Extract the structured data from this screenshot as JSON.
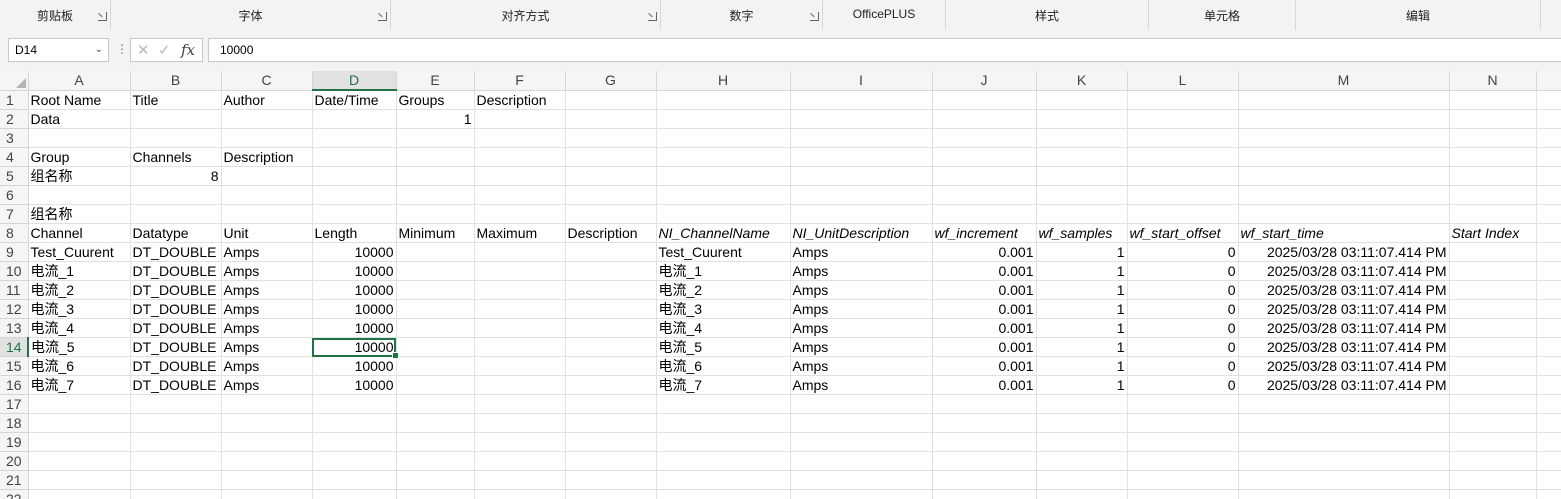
{
  "ribbon": {
    "groups": [
      {
        "label": "剪贴板",
        "launcher": true
      },
      {
        "label": "字体",
        "launcher": true
      },
      {
        "label": "对齐方式",
        "launcher": true
      },
      {
        "label": "数字",
        "launcher": true
      },
      {
        "label": "OfficePLUS",
        "launcher": false
      },
      {
        "label": "样式",
        "launcher": false
      },
      {
        "label": "单元格",
        "launcher": false
      },
      {
        "label": "编辑",
        "launcher": false
      }
    ]
  },
  "formula_bar": {
    "name_box": "D14",
    "formula": "10000",
    "cancel_icon": "✕",
    "enter_icon": "✓",
    "fx_icon": "fx"
  },
  "sheet": {
    "columns": [
      "A",
      "B",
      "C",
      "D",
      "E",
      "F",
      "G",
      "H",
      "I",
      "J",
      "K",
      "L",
      "M",
      "N"
    ],
    "active_column": "D",
    "active_row": 14,
    "rows": [
      {
        "n": 1,
        "cells": {
          "A": "Root Name",
          "B": "Title",
          "C": "Author",
          "D": "Date/Time",
          "E": "Groups",
          "F": "Description"
        },
        "bold": [
          "A",
          "B",
          "C",
          "D",
          "E",
          "F"
        ]
      },
      {
        "n": 2,
        "cells": {
          "A": "Data",
          "E": "1"
        }
      },
      {
        "n": 3,
        "cells": {}
      },
      {
        "n": 4,
        "cells": {
          "A": "Group",
          "B": "Channels",
          "C": "Description"
        },
        "bold": [
          "A",
          "B",
          "C"
        ]
      },
      {
        "n": 5,
        "cells": {
          "A": "组名称",
          "B": "8"
        }
      },
      {
        "n": 6,
        "cells": {}
      },
      {
        "n": 7,
        "cells": {
          "A": "组名称"
        },
        "bold": [
          "A"
        ]
      },
      {
        "n": 8,
        "cells": {
          "A": "Channel",
          "B": "Datatype",
          "C": "Unit",
          "D": "Length",
          "E": "Minimum",
          "F": "Maximum",
          "G": "Description",
          "H": "NI_ChannelName",
          "I": "NI_UnitDescription",
          "J": "wf_increment",
          "K": "wf_samples",
          "L": "wf_start_offset",
          "M": "wf_start_time",
          "N": "Start Index"
        },
        "bold": [
          "A",
          "B",
          "C",
          "D",
          "E",
          "F",
          "G"
        ],
        "italic": [
          "H",
          "I",
          "J",
          "K",
          "L",
          "M",
          "N"
        ]
      },
      {
        "n": 9,
        "cells": {
          "A": "Test_Cuurent",
          "B": "DT_DOUBLE",
          "C": "Amps",
          "D": "10000",
          "H": "Test_Cuurent",
          "I": "Amps",
          "J": "0.001",
          "K": "1",
          "L": "0",
          "M": "2025/03/28 03:11:07.414 PM"
        },
        "bold": [
          "A"
        ]
      },
      {
        "n": 10,
        "cells": {
          "A": "电流_1",
          "B": "DT_DOUBLE",
          "C": "Amps",
          "D": "10000",
          "H": "电流_1",
          "I": "Amps",
          "J": "0.001",
          "K": "1",
          "L": "0",
          "M": "2025/03/28 03:11:07.414 PM"
        },
        "bold": [
          "A"
        ]
      },
      {
        "n": 11,
        "cells": {
          "A": "电流_2",
          "B": "DT_DOUBLE",
          "C": "Amps",
          "D": "10000",
          "H": "电流_2",
          "I": "Amps",
          "J": "0.001",
          "K": "1",
          "L": "0",
          "M": "2025/03/28 03:11:07.414 PM"
        },
        "bold": [
          "A"
        ]
      },
      {
        "n": 12,
        "cells": {
          "A": "电流_3",
          "B": "DT_DOUBLE",
          "C": "Amps",
          "D": "10000",
          "H": "电流_3",
          "I": "Amps",
          "J": "0.001",
          "K": "1",
          "L": "0",
          "M": "2025/03/28 03:11:07.414 PM"
        },
        "bold": [
          "A"
        ]
      },
      {
        "n": 13,
        "cells": {
          "A": "电流_4",
          "B": "DT_DOUBLE",
          "C": "Amps",
          "D": "10000",
          "H": "电流_4",
          "I": "Amps",
          "J": "0.001",
          "K": "1",
          "L": "0",
          "M": "2025/03/28 03:11:07.414 PM"
        },
        "bold": [
          "A"
        ]
      },
      {
        "n": 14,
        "cells": {
          "A": "电流_5",
          "B": "DT_DOUBLE",
          "C": "Amps",
          "D": "10000",
          "H": "电流_5",
          "I": "Amps",
          "J": "0.001",
          "K": "1",
          "L": "0",
          "M": "2025/03/28 03:11:07.414 PM"
        },
        "bold": [
          "A"
        ]
      },
      {
        "n": 15,
        "cells": {
          "A": "电流_6",
          "B": "DT_DOUBLE",
          "C": "Amps",
          "D": "10000",
          "H": "电流_6",
          "I": "Amps",
          "J": "0.001",
          "K": "1",
          "L": "0",
          "M": "2025/03/28 03:11:07.414 PM"
        },
        "bold": [
          "A"
        ]
      },
      {
        "n": 16,
        "cells": {
          "A": "电流_7",
          "B": "DT_DOUBLE",
          "C": "Amps",
          "D": "10000",
          "H": "电流_7",
          "I": "Amps",
          "J": "0.001",
          "K": "1",
          "L": "0",
          "M": "2025/03/28 03:11:07.414 PM"
        },
        "bold": [
          "A"
        ]
      },
      {
        "n": 17,
        "cells": {}
      },
      {
        "n": 18,
        "cells": {}
      },
      {
        "n": 19,
        "cells": {}
      },
      {
        "n": 20,
        "cells": {}
      },
      {
        "n": 21,
        "cells": {}
      },
      {
        "n": 22,
        "cells": {}
      }
    ],
    "right_aligned_columns": [
      "D",
      "E",
      "J",
      "K",
      "L",
      "M"
    ],
    "right_aligned_b_rows": [
      5
    ]
  }
}
